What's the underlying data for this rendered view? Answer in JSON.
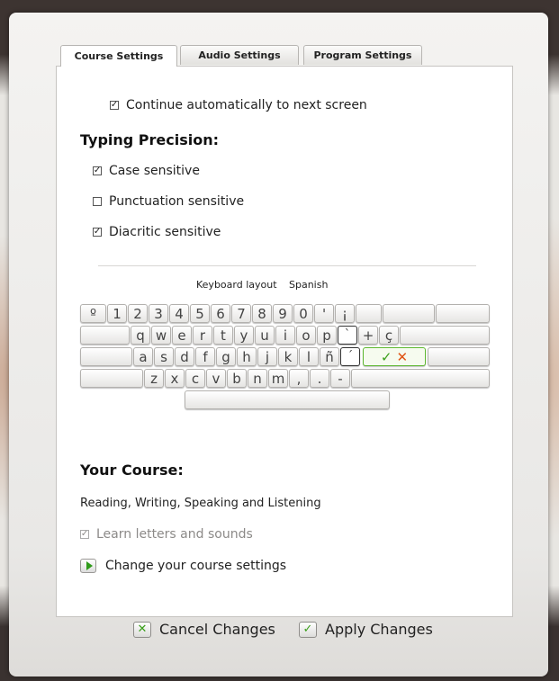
{
  "tabs": [
    {
      "label": "Course Settings",
      "active": true
    },
    {
      "label": "Audio Settings",
      "active": false
    },
    {
      "label": "Program Settings",
      "active": false
    }
  ],
  "continue_auto": {
    "label": "Continue automatically to next screen",
    "checked": true
  },
  "typing_precision": {
    "heading": "Typing Precision:",
    "options": [
      {
        "label": "Case sensitive",
        "checked": true
      },
      {
        "label": "Punctuation sensitive",
        "checked": false
      },
      {
        "label": "Diacritic sensitive",
        "checked": true
      }
    ]
  },
  "keyboard": {
    "layout_label": "Keyboard layout",
    "layout_value": "Spanish",
    "row1": [
      "º",
      "1",
      "2",
      "3",
      "4",
      "5",
      "6",
      "7",
      "8",
      "9",
      "0",
      "'",
      "¡"
    ],
    "row2": [
      "q",
      "w",
      "e",
      "r",
      "t",
      "y",
      "u",
      "i",
      "o",
      "p",
      "`",
      "+",
      "ç"
    ],
    "row3": [
      "a",
      "s",
      "d",
      "f",
      "g",
      "h",
      "j",
      "k",
      "l",
      "ñ",
      "´"
    ],
    "row4": [
      "z",
      "x",
      "c",
      "v",
      "b",
      "n",
      "m",
      ",",
      ".",
      "-"
    ],
    "confirm_ok": "✓",
    "confirm_no": "✕"
  },
  "course": {
    "heading": "Your Course:",
    "name": "Reading, Writing, Speaking and Listening",
    "learn_letters": {
      "label": "Learn letters and sounds",
      "checked": true,
      "disabled": true
    },
    "change_link": "Change your course settings"
  },
  "footer": {
    "cancel_label": "Cancel Changes",
    "apply_label": "Apply Changes"
  },
  "colors": {
    "accent_green": "#3a9f1a",
    "accent_orange": "#e05414"
  }
}
